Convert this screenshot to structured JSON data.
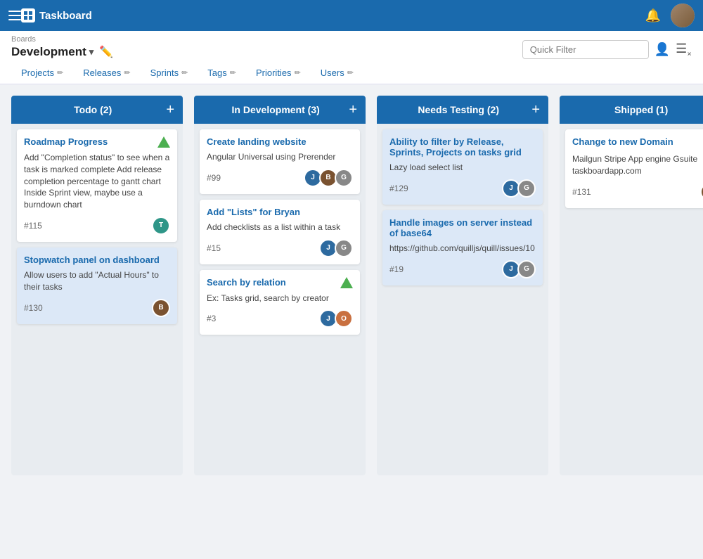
{
  "app": {
    "logo_text": "Taskboard",
    "boards_label": "Boards",
    "board_name": "Development"
  },
  "nav": {
    "quick_filter_placeholder": "Quick Filter",
    "links": [
      {
        "label": "Projects",
        "id": "projects"
      },
      {
        "label": "Releases",
        "id": "releases"
      },
      {
        "label": "Sprints",
        "id": "sprints"
      },
      {
        "label": "Tags",
        "id": "tags"
      },
      {
        "label": "Priorities",
        "id": "priorities"
      },
      {
        "label": "Users",
        "id": "users"
      }
    ]
  },
  "columns": [
    {
      "id": "todo",
      "title": "Todo",
      "count": 2,
      "cards": [
        {
          "id": "card-115",
          "title": "Roadmap Progress",
          "desc": "Add \"Completion status\" to see when a task is marked complete Add release completion percentage to gantt chart Inside Sprint view, maybe use a burndown chart",
          "number": "#115",
          "highlight": false,
          "icon": "success",
          "avatars": [
            "av-teal"
          ]
        },
        {
          "id": "card-130",
          "title": "Stopwatch panel on dashboard",
          "desc": "Allow users to add \"Actual Hours\" to their tasks",
          "number": "#130",
          "highlight": true,
          "icon": null,
          "avatars": [
            "av-brown"
          ]
        }
      ]
    },
    {
      "id": "in-development",
      "title": "In Development",
      "count": 3,
      "cards": [
        {
          "id": "card-99",
          "title": "Create landing website",
          "desc": "Angular Universal using Prerender",
          "number": "#99",
          "highlight": false,
          "icon": null,
          "avatars": [
            "av-blue",
            "av-brown",
            "av-gray"
          ]
        },
        {
          "id": "card-15",
          "title": "Add \"Lists\" for Bryan",
          "desc": "Add checklists as a list within a task",
          "number": "#15",
          "highlight": false,
          "icon": null,
          "avatars": [
            "av-blue",
            "av-gray"
          ]
        },
        {
          "id": "card-3",
          "title": "Search by relation",
          "desc": "Ex: Tasks grid, search by creator",
          "number": "#3",
          "highlight": false,
          "icon": "success",
          "avatars": [
            "av-blue",
            "av-orange"
          ]
        }
      ]
    },
    {
      "id": "needs-testing",
      "title": "Needs Testing",
      "count": 2,
      "cards": [
        {
          "id": "card-129",
          "title": "Ability to filter by Release, Sprints, Projects on tasks grid",
          "desc": "Lazy load select list",
          "number": "#129",
          "highlight": true,
          "icon": null,
          "avatars": [
            "av-blue",
            "av-gray"
          ]
        },
        {
          "id": "card-19",
          "title": "Handle images on server instead of base64",
          "desc": "https://github.com/quilljs/quill/issues/10",
          "number": "#19",
          "highlight": true,
          "icon": null,
          "avatars": [
            "av-blue",
            "av-gray"
          ]
        }
      ]
    },
    {
      "id": "shipped",
      "title": "Shipped",
      "count": 1,
      "cards": [
        {
          "id": "card-131",
          "title": "Change to new Domain",
          "desc": "Mailgun Stripe App engine Gsuite taskboardapp.com",
          "number": "#131",
          "highlight": false,
          "icon": "warning",
          "avatars": [
            "av-brown"
          ]
        }
      ]
    }
  ]
}
